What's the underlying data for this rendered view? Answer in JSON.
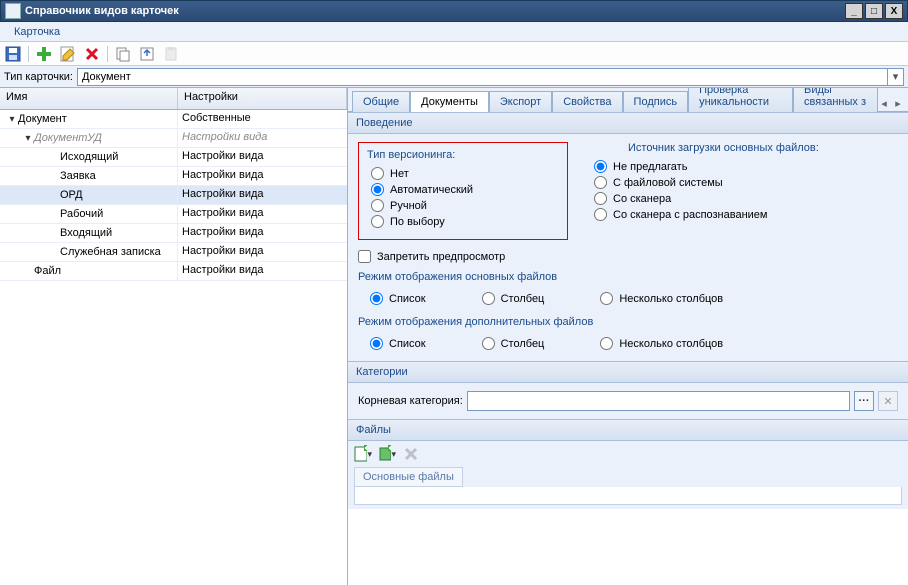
{
  "window": {
    "title": "Справочник видов карточек"
  },
  "menu": {
    "card": "Карточка"
  },
  "cardtype": {
    "label": "Тип карточки:",
    "value": "Документ"
  },
  "tree": {
    "col_name": "Имя",
    "col_settings": "Настройки",
    "rows": [
      {
        "ind": 0,
        "twisty": "▾",
        "name": "Документ",
        "settings": "Собственные",
        "sel": false,
        "italic": false
      },
      {
        "ind": 1,
        "twisty": "▾",
        "name": "ДокументУД",
        "settings": "Настройки вида",
        "sel": false,
        "italic": true
      },
      {
        "ind": 2,
        "twisty": "",
        "name": "Исходящий",
        "settings": "Настройки вида",
        "sel": false,
        "italic": false
      },
      {
        "ind": 2,
        "twisty": "",
        "name": "Заявка",
        "settings": "Настройки вида",
        "sel": false,
        "italic": false
      },
      {
        "ind": 2,
        "twisty": "",
        "name": "ОРД",
        "settings": "Настройки вида",
        "sel": true,
        "italic": false
      },
      {
        "ind": 2,
        "twisty": "",
        "name": "Рабочий",
        "settings": "Настройки вида",
        "sel": false,
        "italic": false
      },
      {
        "ind": 2,
        "twisty": "",
        "name": "Входящий",
        "settings": "Настройки вида",
        "sel": false,
        "italic": false
      },
      {
        "ind": 2,
        "twisty": "",
        "name": "Служебная записка",
        "settings": "Настройки вида",
        "sel": false,
        "italic": false
      },
      {
        "ind": 1,
        "twisty": "",
        "name": "Файл",
        "settings": "Настройки вида",
        "sel": false,
        "italic": false
      }
    ]
  },
  "tabs": {
    "items": [
      "Общие",
      "Документы",
      "Экспорт",
      "Свойства",
      "Подпись",
      "Проверка уникальности",
      "Виды связанных з"
    ],
    "active": 1
  },
  "behavior": {
    "title": "Поведение",
    "versioning_label": "Тип версионинга:",
    "versioning": {
      "none": "Нет",
      "auto": "Автоматический",
      "manual": "Ручной",
      "choice": "По выбору"
    },
    "source_label": "Источник загрузки основных файлов:",
    "source": {
      "noprompt": "Не предлагать",
      "fs": "С файловой системы",
      "scanner": "Со сканера",
      "scanner_ocr": "Со сканера с распознаванием"
    },
    "forbid_preview": "Запретить предпросмотр",
    "main_files_mode_label": "Режим отображения основных файлов",
    "extra_files_mode_label": "Режим отображения дополнительных файлов",
    "mode": {
      "list": "Список",
      "column": "Столбец",
      "multi": "Несколько столбцов"
    }
  },
  "categories": {
    "title": "Категории",
    "root_label": "Корневая категория:"
  },
  "files": {
    "title": "Файлы",
    "main_tab": "Основные файлы"
  }
}
